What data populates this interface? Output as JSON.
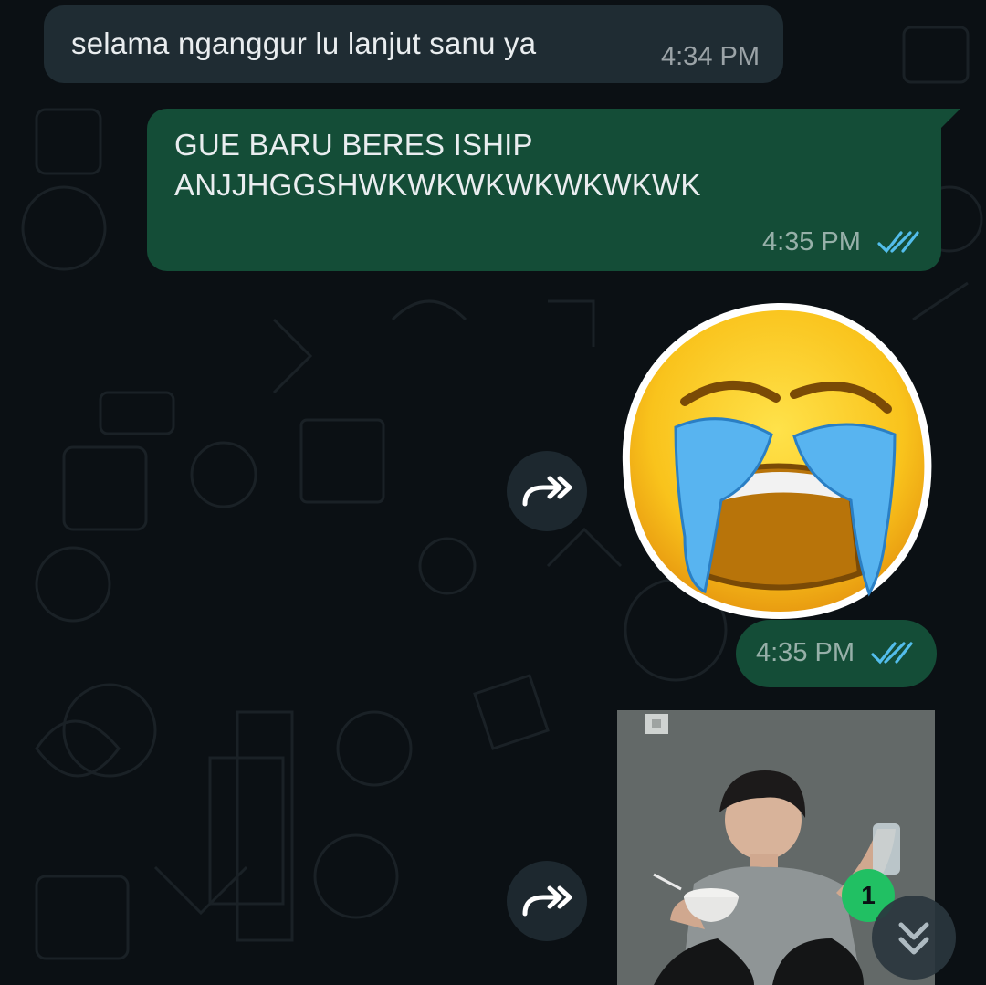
{
  "messages": [
    {
      "direction": "incoming",
      "text": "selama nganggur lu lanjut sanu ya",
      "time": "4:34 PM"
    },
    {
      "direction": "outgoing",
      "text_line1": "GUE BARU BERES ISHIP",
      "text_line2": "ANJJHGGSHWKWKWKWKWKWKWK",
      "time": "4:35 PM",
      "status": "read"
    },
    {
      "direction": "outgoing",
      "type": "sticker",
      "sticker_icon": "loudly-crying-face-sticker",
      "time": "4:35 PM",
      "status": "read"
    },
    {
      "direction": "outgoing",
      "type": "photo",
      "photo_icon": "person-eating-photo"
    }
  ],
  "unread_badge": "1",
  "colors": {
    "background": "#0b1014",
    "incoming_bubble": "#1f2c33",
    "outgoing_bubble": "#144d37",
    "read_ticks": "#53bdeb",
    "badge": "#21c063"
  },
  "icons": {
    "forward": "forward-icon",
    "read_receipt": "double-check-icon",
    "scroll_down": "double-chevron-down-icon"
  }
}
